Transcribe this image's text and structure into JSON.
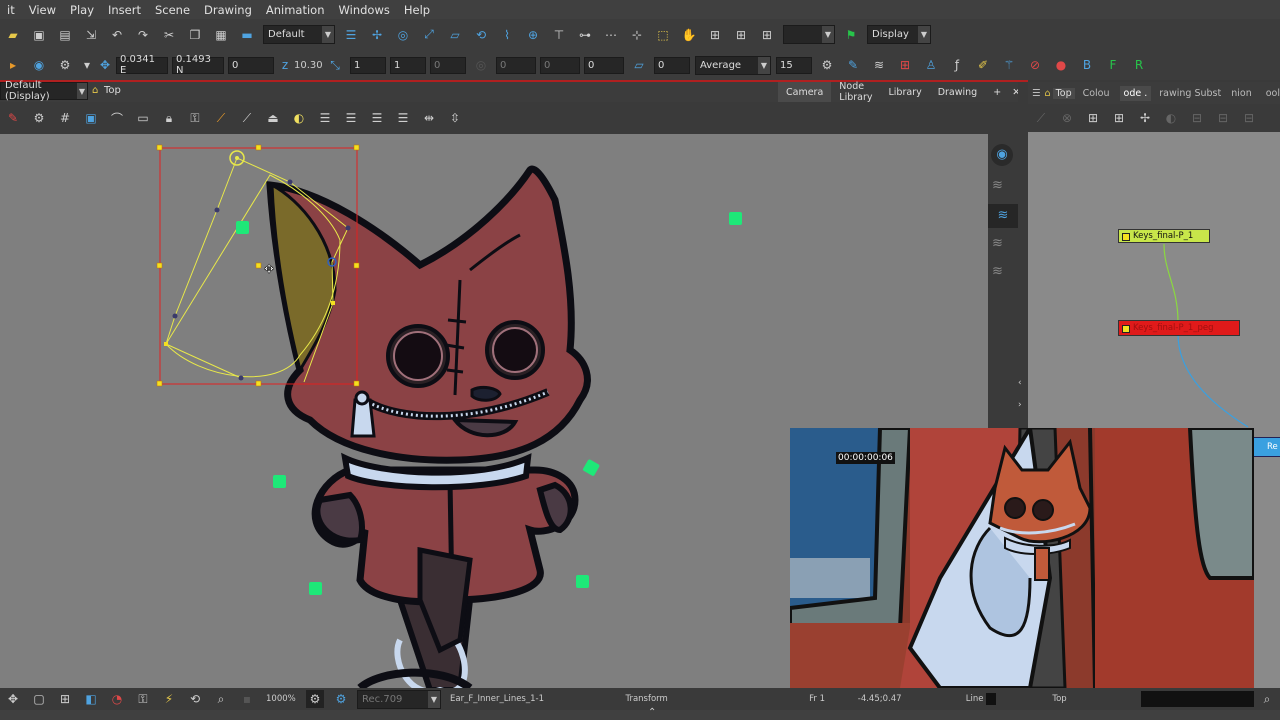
{
  "menu": [
    "it",
    "View",
    "Play",
    "Insert",
    "Scene",
    "Drawing",
    "Animation",
    "Windows",
    "Help"
  ],
  "toolbar1": {
    "palette_select": "Default",
    "display_select": "Display"
  },
  "toolbar2": {
    "x_value": "0.0341 E",
    "y_value": "0.1493 N",
    "z_value": "0",
    "z_label": "10.30",
    "scale_x": "1",
    "scale_y": "1",
    "scale_z": "0",
    "rot_a": "0",
    "rot_b": "0",
    "rot_c": "0",
    "skew": "0",
    "smooth_mode": "Average",
    "smooth_value": "15"
  },
  "viewer": {
    "display_select": "Default (Display)",
    "breadcrumb": "Top",
    "tabs": [
      "Camera",
      "Node Library",
      "Library",
      "Drawing"
    ],
    "active_tab": "Camera"
  },
  "node_view": {
    "breadcrumb": "Top",
    "tabs": [
      "Colou",
      "ode .",
      "rawing Subst",
      "nion",
      "ool"
    ],
    "nodes": [
      {
        "label": "Keys_final-P_1",
        "color": "#c8e64a"
      },
      {
        "label": "Keys_final-P_1_peg",
        "color": "#e01a1a"
      }
    ],
    "partial_label": "Re"
  },
  "preview": {
    "timecode": "00:00:00:06"
  },
  "status": {
    "zoom": "1000%",
    "rec": "Rec.709",
    "layer": "Ear_F_Inner_Lines_1-1",
    "tool": "Transform",
    "frame": "Fr 1",
    "coords": "-4.45;0.47",
    "line_label": "Line",
    "top_label": "Top"
  },
  "colors": {
    "character_body": "#8b4245",
    "outline": "#0d0d14",
    "selection_box": "#e02020",
    "bezier": "#e8e84a",
    "pivot_green": "#1ee878",
    "ear_fill": "#7a6a2a"
  }
}
